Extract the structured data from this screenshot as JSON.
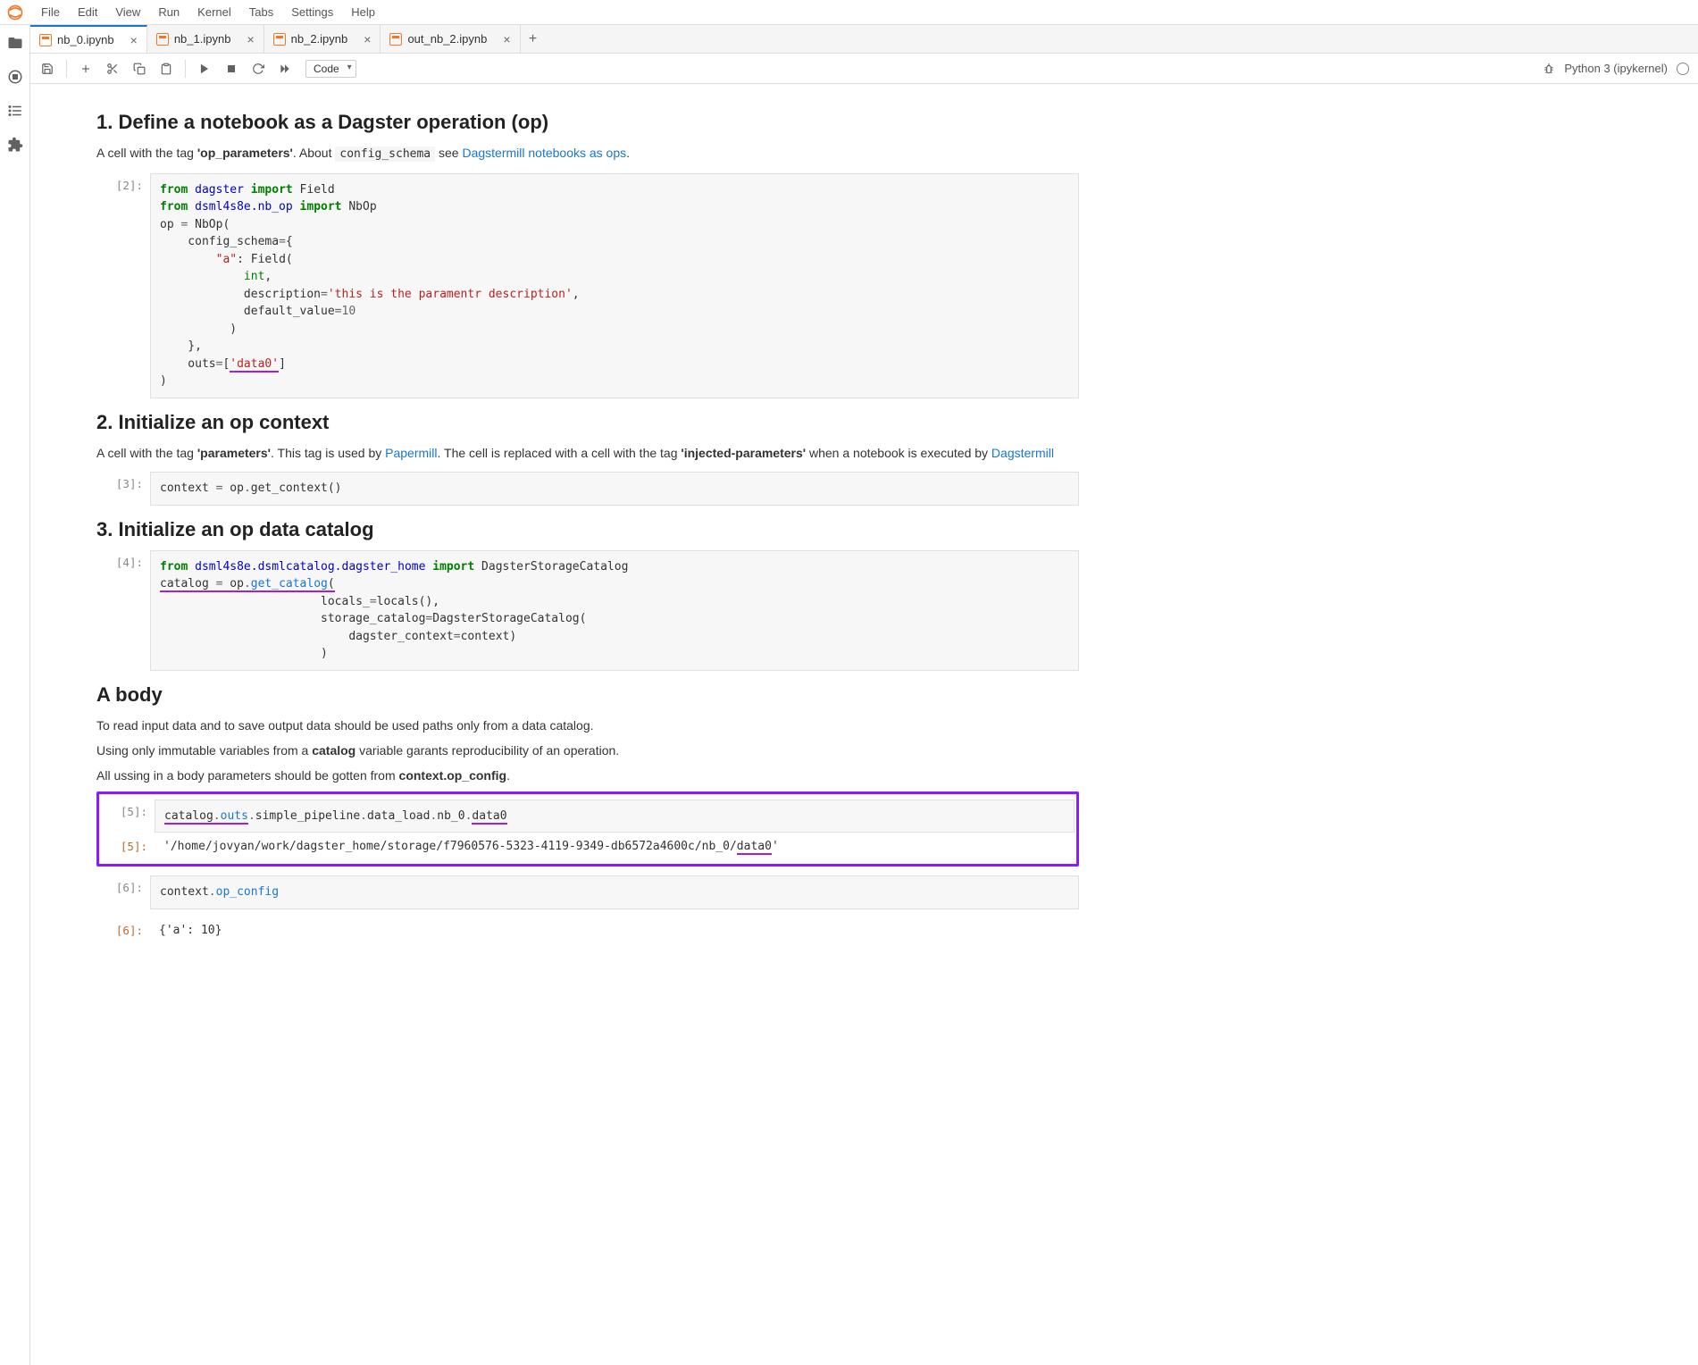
{
  "menubar": {
    "items": [
      "File",
      "Edit",
      "View",
      "Run",
      "Kernel",
      "Tabs",
      "Settings",
      "Help"
    ]
  },
  "tabs": [
    {
      "label": "nb_0.ipynb",
      "active": true
    },
    {
      "label": "nb_1.ipynb",
      "active": false
    },
    {
      "label": "nb_2.ipynb",
      "active": false
    },
    {
      "label": "out_nb_2.ipynb",
      "active": false
    }
  ],
  "toolbar": {
    "cell_type": "Code",
    "kernel": "Python 3 (ipykernel)"
  },
  "section1": {
    "heading": "1. Define a notebook as a Dagster operation (op)",
    "text_pre": "A cell with the tag ",
    "text_bold": "'op_parameters'",
    "text_mid": ". About ",
    "code": "config_schema",
    "text_see": " see ",
    "link": "Dagstermill notebooks as ops",
    "cell_prompt": "[2]:"
  },
  "section2": {
    "heading": "2. Initialize an op context",
    "t1": "A cell with the tag ",
    "b1": "'parameters'",
    "t2": ". This tag is used by ",
    "link1": "Papermill",
    "t3": ". The cell is replaced with a cell with the tag ",
    "b2": "'injected-parameters'",
    "t4": " when a notebook is executed by ",
    "link2": "Dagstermill",
    "cell_prompt": "[3]:"
  },
  "section3": {
    "heading": "3. Initialize an op data catalog",
    "cell_prompt": "[4]:"
  },
  "section4": {
    "heading": "A body",
    "p1": "To read input data and to save output data should be used paths only from a data catalog.",
    "p2a": "Using only immutable variables from a ",
    "p2b": "catalog",
    "p2c": " variable garants reproducibility of an operation.",
    "p3a": "All ussing in a body parameters should be gotten from ",
    "p3b": "context.op_config",
    "p3c": ".",
    "cell5_prompt": "[5]:",
    "cell5_out_prompt": "[5]:",
    "cell5_out": "'/home/jovyan/work/dagster_home/storage/f7960576-5323-4119-9349-db6572a4600c/nb_0/data0'",
    "cell6_prompt": "[6]:",
    "cell6_out_prompt": "[6]:",
    "cell6_out": "{'a': 10}"
  }
}
